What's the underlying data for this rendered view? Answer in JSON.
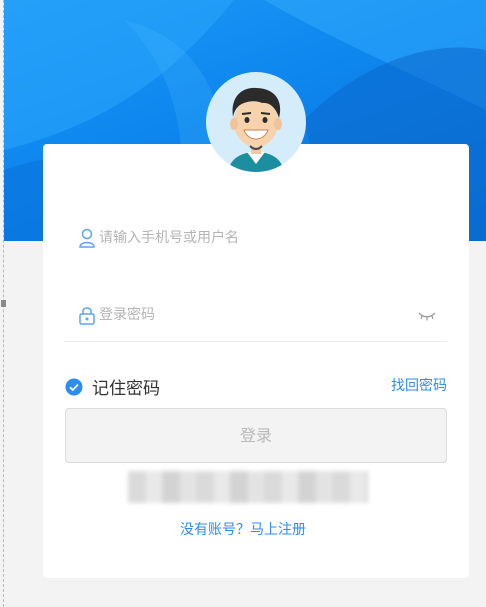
{
  "login": {
    "username_placeholder": "请输入手机号或用户名",
    "password_placeholder": "登录密码",
    "remember_label": "记住密码",
    "remember_checked": true,
    "forgot_link": "找回密码",
    "login_button": "登录",
    "register_link": "没有账号？马上注册"
  },
  "icons": {
    "avatar": "user-avatar",
    "user": "person-icon",
    "lock": "lock-icon",
    "eye": "eye-closed-icon",
    "check": "checkmark-circle-icon"
  },
  "colors": {
    "banner": "#1e9af6",
    "link": "#2c8cf0",
    "check": "#2c8cf0"
  }
}
